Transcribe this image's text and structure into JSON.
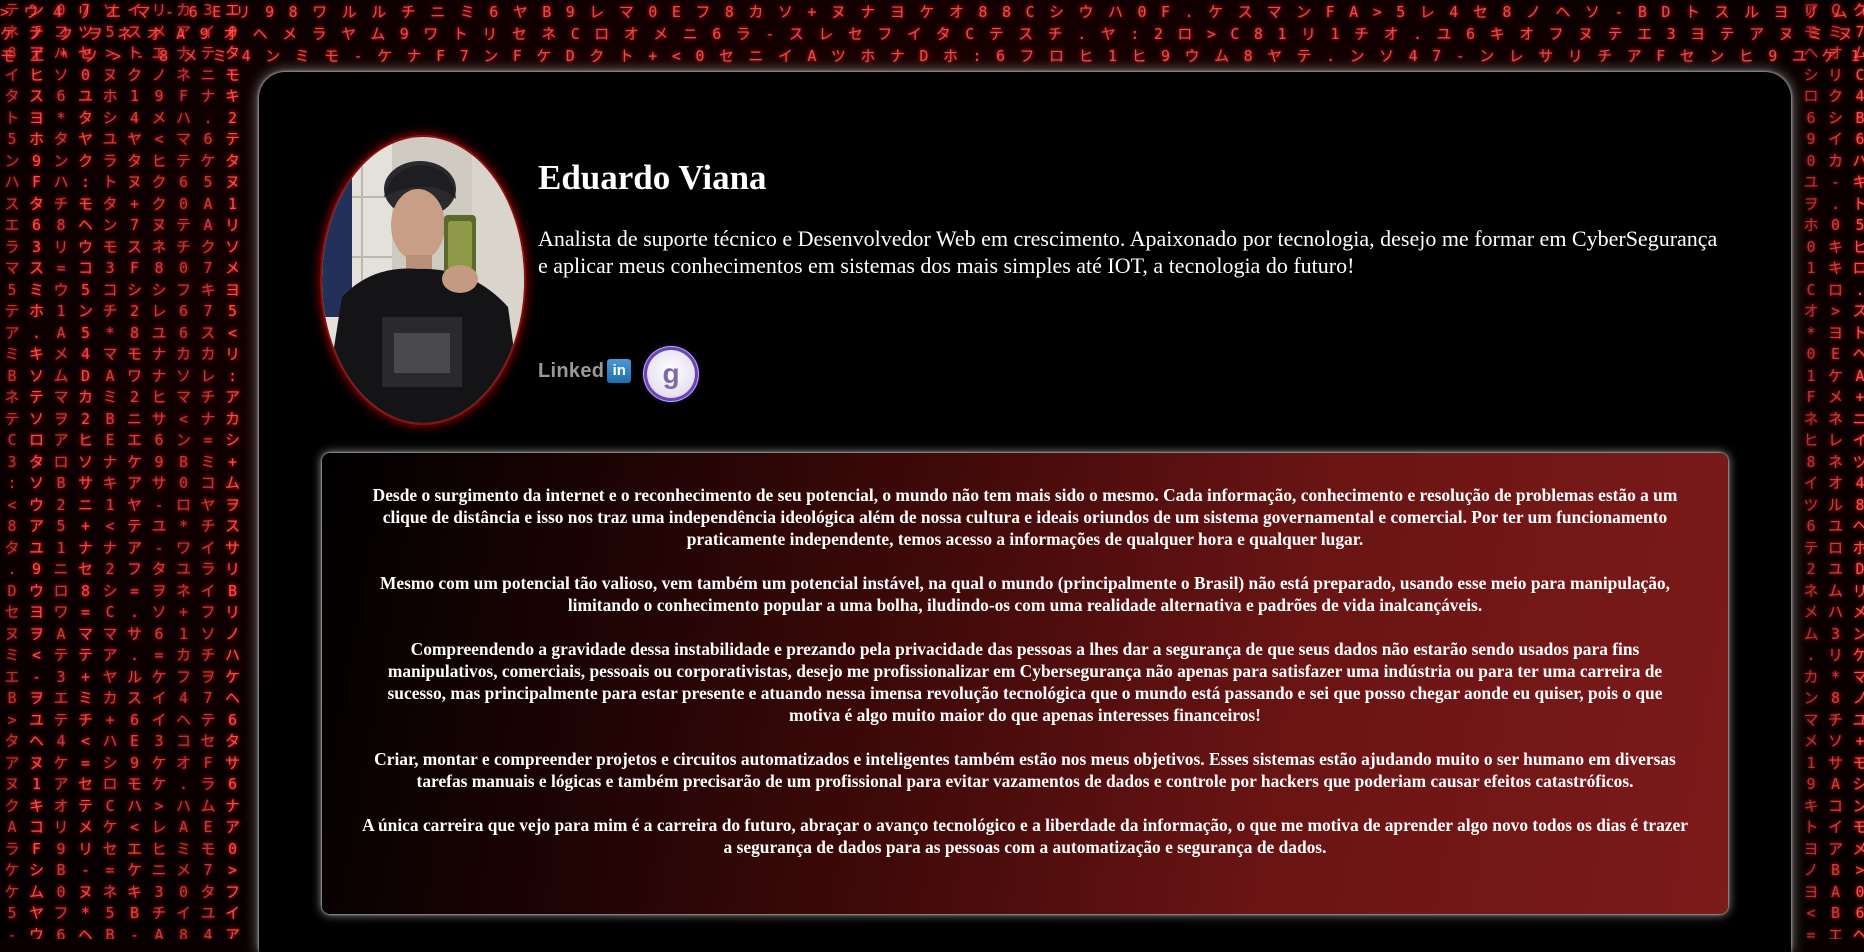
{
  "profile": {
    "name": "Eduardo Viana",
    "bio": "Analista de suporte técnico e Desenvolvedor Web em crescimento. Apaixonado por tecnologia, desejo me formar em CyberSegurança e aplicar meus conhecimentos em sistemas dos mais simples até IOT, a tecnologia do futuro!",
    "avatar_icon": "profile-photo"
  },
  "social": {
    "linkedin_word": "Linked",
    "linkedin_box": "in",
    "linkedin_icon": "linkedin-logo",
    "gitbadge_letter": "g",
    "gitbadge_icon": "git-badge-logo"
  },
  "about": {
    "paragraphs": [
      "Desde o surgimento da internet e o reconhecimento de seu potencial, o mundo não tem mais sido o mesmo. Cada informação, conhecimento e resolução de problemas estão a um clique de distância e isso nos traz uma independência ideológica além de nossa cultura e ideais oriundos de um sistema governamental e comercial. Por ter um funcionamento praticamente independente, temos acesso a informações de qualquer hora e qualquer lugar.",
      "Mesmo com um potencial tão valioso, vem também um potencial instável, na qual o mundo (principalmente o Brasil) não está preparado, usando esse meio para manipulação, limitando o conhecimento popular a uma bolha, iludindo-os com uma realidade alternativa e padrões de vida inalcançáveis.",
      "Compreendendo a gravidade dessa instabilidade e prezando pela privacidade das pessoas a lhes dar a segurança de que seus dados não estarão sendo usados para fins manipulativos, comerciais, pessoais ou corporativistas, desejo me profissionalizar em Cybersegurança não apenas para satisfazer uma indústria ou para ter uma carreira de sucesso, mas principalmente para estar presente e atuando nessa imensa revolução tecnológica que o mundo está passando e sei que posso chegar aonde eu quiser, pois o que motiva é algo muito maior do que apenas interesses financeiros!",
      "Criar, montar e compreender projetos e circuitos automatizados e inteligentes também estão nos meus objetivos. Esses sistemas estão ajudando muito o ser humano em diversas tarefas manuais e lógicas e também precisarão de um profissional para evitar vazamentos de dados e controle por hackers que poderiam causar efeitos catastróficos.",
      "A única carreira que vejo para mim é a carreira do futuro, abraçar o avanço tecnológico e a liberdade da informação, o que me motiva de aprender algo novo todos os dias é trazer a segurança de dados para as pessoas com a automatização e segurança de dados."
    ]
  },
  "background": {
    "icon": "matrix-rain-background",
    "glyph_color": "#ff5a5a",
    "accent_color": "#8a1010"
  }
}
